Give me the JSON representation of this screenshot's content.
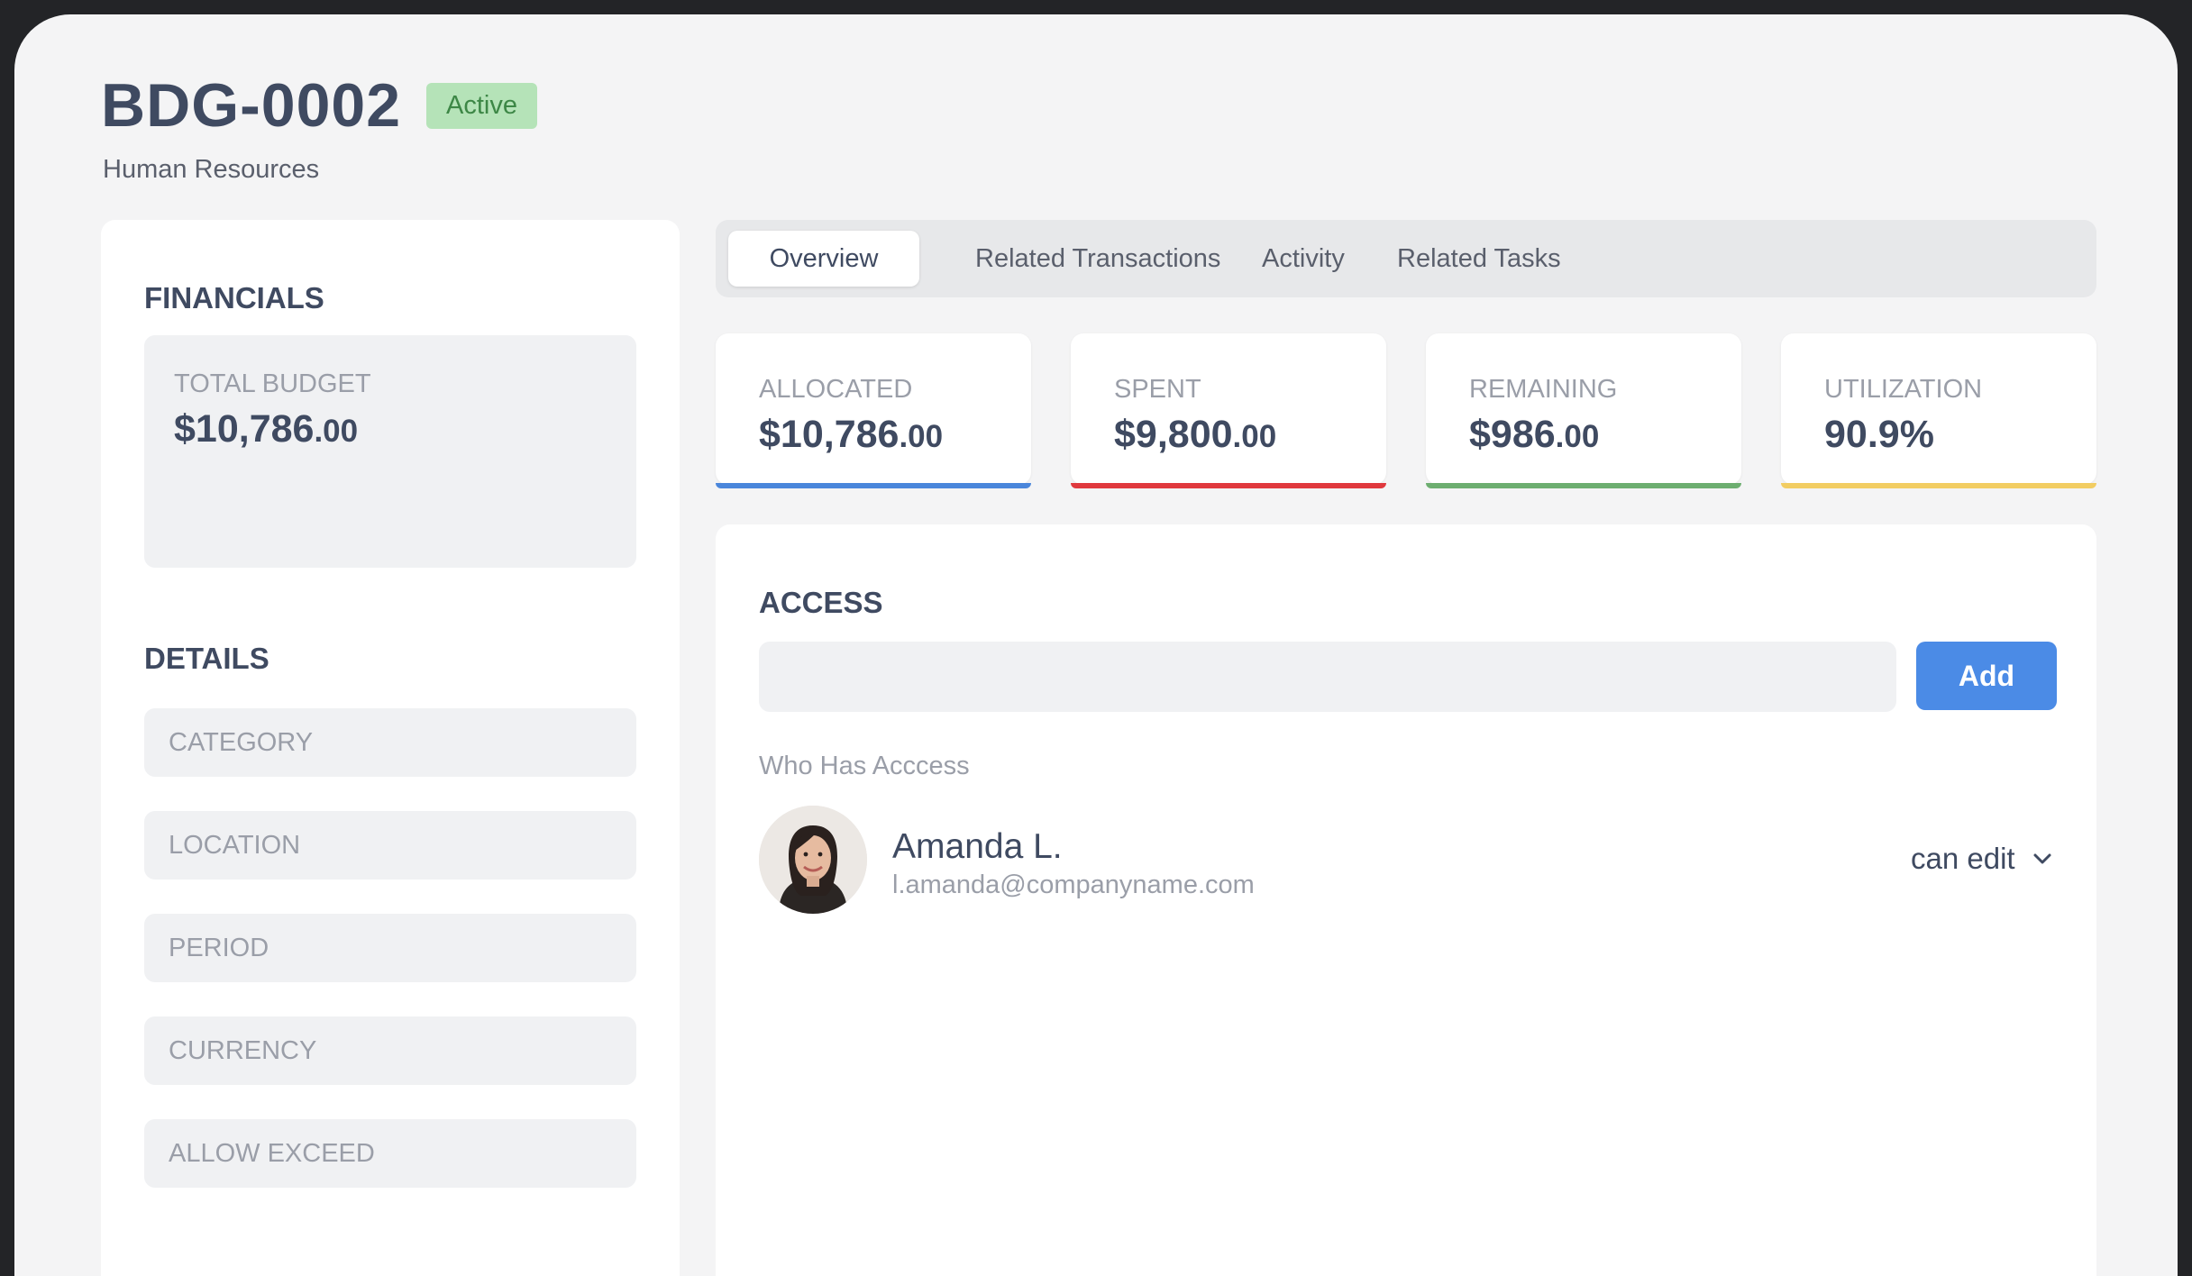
{
  "header": {
    "title": "BDG-0002",
    "status": "Active",
    "department": "Human Resources"
  },
  "financials": {
    "title": "FINANCIALS",
    "total_budget_label": "TOTAL BUDGET",
    "total_budget_main": "$10,786",
    "total_budget_cents": ".00"
  },
  "details": {
    "title": "DETAILS",
    "fields": [
      "CATEGORY",
      "LOCATION",
      "PERIOD",
      "CURRENCY",
      "ALLOW EXCEED"
    ]
  },
  "tabs": [
    "Overview",
    "Related Transactions",
    "Activity",
    "Related Tasks"
  ],
  "stats": [
    {
      "label": "ALLOCATED",
      "main": "$10,786",
      "cents": ".00",
      "color": "#4a86db"
    },
    {
      "label": "SPENT",
      "main": "$9,800",
      "cents": ".00",
      "color": "#e0393e"
    },
    {
      "label": "REMAINING",
      "main": "$986",
      "cents": ".00",
      "color": "#6dae70"
    },
    {
      "label": "UTILIZATION",
      "main": "90.9%",
      "cents": "",
      "color": "#f2cd63"
    }
  ],
  "access": {
    "title": "ACCESS",
    "input_value": "",
    "add_label": "Add",
    "who_label": "Who Has Acccess",
    "users": [
      {
        "name": "Amanda L.",
        "email": "l.amanda@companyname.com",
        "permission": "can edit"
      }
    ]
  }
}
